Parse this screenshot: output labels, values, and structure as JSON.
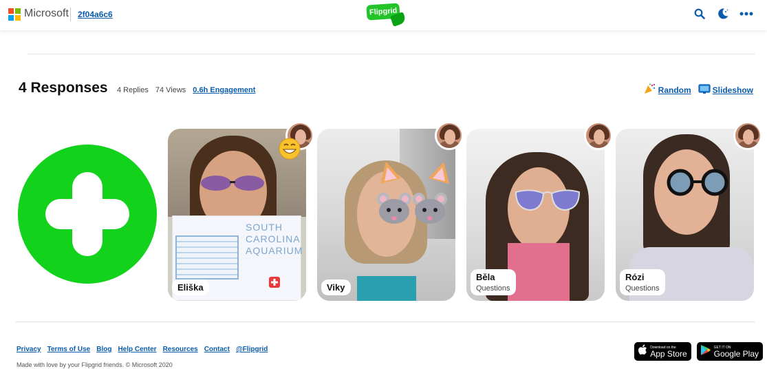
{
  "header": {
    "brand_word": "Microsoft",
    "group_code": "2f04a6c6",
    "logo_text": "Flipgrid",
    "icons": [
      "search-icon",
      "moon-icon",
      "more-icon"
    ]
  },
  "responses": {
    "title": "4 Responses",
    "replies": "4 Replies",
    "views": "74 Views",
    "engagement": "0.6h Engagement",
    "random_label": "Random",
    "slideshow_label": "Slideshow"
  },
  "cards": [
    {
      "name": "Eliška",
      "subtitle": ""
    },
    {
      "name": "Viky",
      "subtitle": ""
    },
    {
      "name": "Běla",
      "subtitle": "Questions"
    },
    {
      "name": "Rózi",
      "subtitle": "Questions"
    }
  ],
  "footer": {
    "links": [
      "Privacy",
      "Terms of Use",
      "Blog",
      "Help Center",
      "Resources",
      "Contact",
      "@Flipgrid"
    ],
    "copyright": "Made with love by your Flipgrid friends. © Microsoft 2020",
    "app_store_small": "Download on the",
    "app_store_big": "App Store",
    "google_play_small": "GET IT ON",
    "google_play_big": "Google Play"
  },
  "colors": {
    "accent_green": "#12d21c",
    "link_blue": "#0b5cad"
  }
}
